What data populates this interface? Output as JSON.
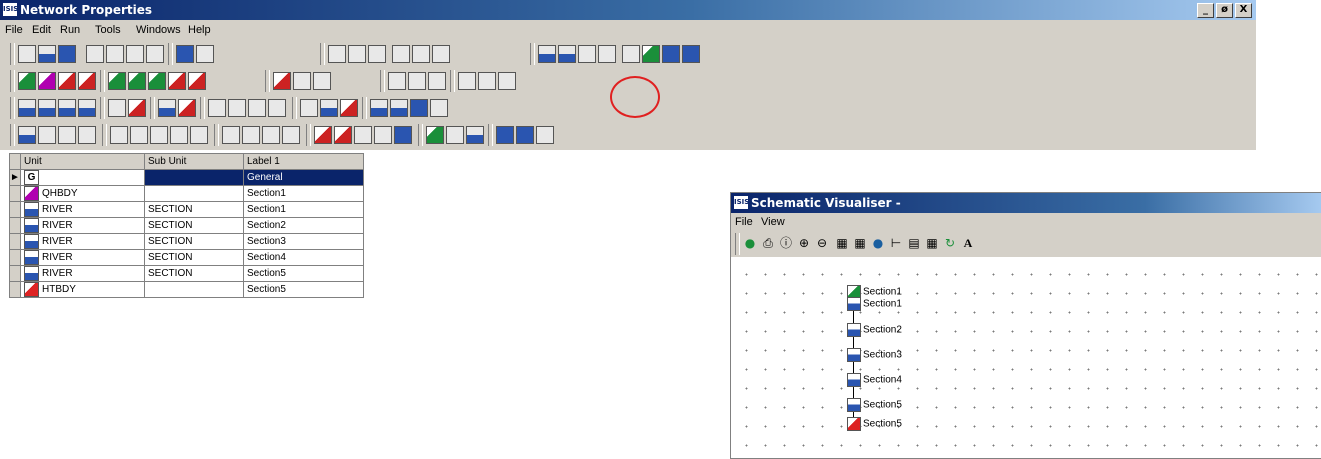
{
  "main_window": {
    "title": "Network Properties",
    "logo_text": "ISIS",
    "window_buttons": [
      "_",
      "ø",
      "X"
    ]
  },
  "menu": [
    "File",
    "Edit",
    "Run",
    "Tools",
    "Windows",
    "Help"
  ],
  "table": {
    "headers": [
      "Unit",
      "Sub Unit",
      "Label 1"
    ],
    "rows": [
      {
        "icon": "general-icon",
        "unit": "",
        "icon_text": "G",
        "sub_unit": "",
        "label": "General",
        "selected": true
      },
      {
        "icon": "qhbdy-icon",
        "unit": "QHBDY",
        "icon_text": "",
        "sub_unit": "",
        "label": "Section1"
      },
      {
        "icon": "river-icon",
        "unit": "RIVER",
        "icon_text": "",
        "sub_unit": "SECTION",
        "label": "Section1"
      },
      {
        "icon": "river-icon",
        "unit": "RIVER",
        "icon_text": "",
        "sub_unit": "SECTION",
        "label": "Section2"
      },
      {
        "icon": "river-icon",
        "unit": "RIVER",
        "icon_text": "",
        "sub_unit": "SECTION",
        "label": "Section3"
      },
      {
        "icon": "river-icon",
        "unit": "RIVER",
        "icon_text": "",
        "sub_unit": "SECTION",
        "label": "Section4"
      },
      {
        "icon": "river-icon",
        "unit": "RIVER",
        "icon_text": "",
        "sub_unit": "SECTION",
        "label": "Section5"
      },
      {
        "icon": "htbdy-icon",
        "unit": "HTBDY",
        "icon_text": "",
        "sub_unit": "",
        "label": "Section5"
      }
    ]
  },
  "schematic_window": {
    "title": "Schematic Visualiser -",
    "logo_text": "ISIS",
    "menu": [
      "File",
      "View"
    ],
    "toolbar_letter": "A",
    "nodes": [
      {
        "icon": "qhbdy-icon",
        "label": "Section1"
      },
      {
        "icon": "river-icon",
        "label": "Section1"
      },
      {
        "icon": "river-icon",
        "label": "Section2"
      },
      {
        "icon": "river-icon",
        "label": "Section3"
      },
      {
        "icon": "river-icon",
        "label": "Section4"
      },
      {
        "icon": "river-icon",
        "label": "Section5"
      },
      {
        "icon": "htbdy-icon",
        "label": "Section5"
      }
    ]
  },
  "colors": {
    "titlebar": "#0a246a",
    "selection": "#0a246a",
    "highlight_ring": "#e02020",
    "chrome": "#d4d0c8"
  }
}
